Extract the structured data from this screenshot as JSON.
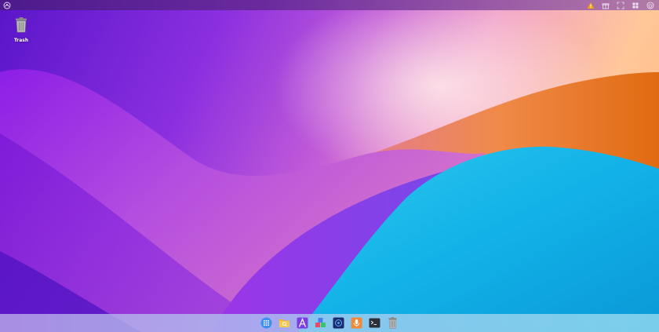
{
  "desktop": {
    "icons": [
      {
        "label": "Trash",
        "icon": "trash-icon"
      }
    ]
  },
  "top_panel": {
    "left_icon": "launcher-logo-icon",
    "tray_icons": [
      "warning-icon",
      "gift-icon",
      "screenshot-icon",
      "grid-icon",
      "power-icon"
    ]
  },
  "dock": {
    "items": [
      {
        "name": "app-launcher",
        "icon": "app-grid-icon"
      },
      {
        "name": "file-manager",
        "icon": "folder-search-icon"
      },
      {
        "name": "app-store",
        "icon": "app-store-icon"
      },
      {
        "name": "settings-cubes",
        "icon": "cubes-icon"
      },
      {
        "name": "system-monitor",
        "icon": "monitor-icon"
      },
      {
        "name": "voice-recorder",
        "icon": "microphone-icon"
      },
      {
        "name": "terminal",
        "icon": "terminal-icon"
      },
      {
        "name": "trash",
        "icon": "trash-icon"
      }
    ]
  },
  "colors": {
    "panel": "#5a2596",
    "warning": "#f2a20d",
    "dock_bg": "#b4cdef"
  }
}
